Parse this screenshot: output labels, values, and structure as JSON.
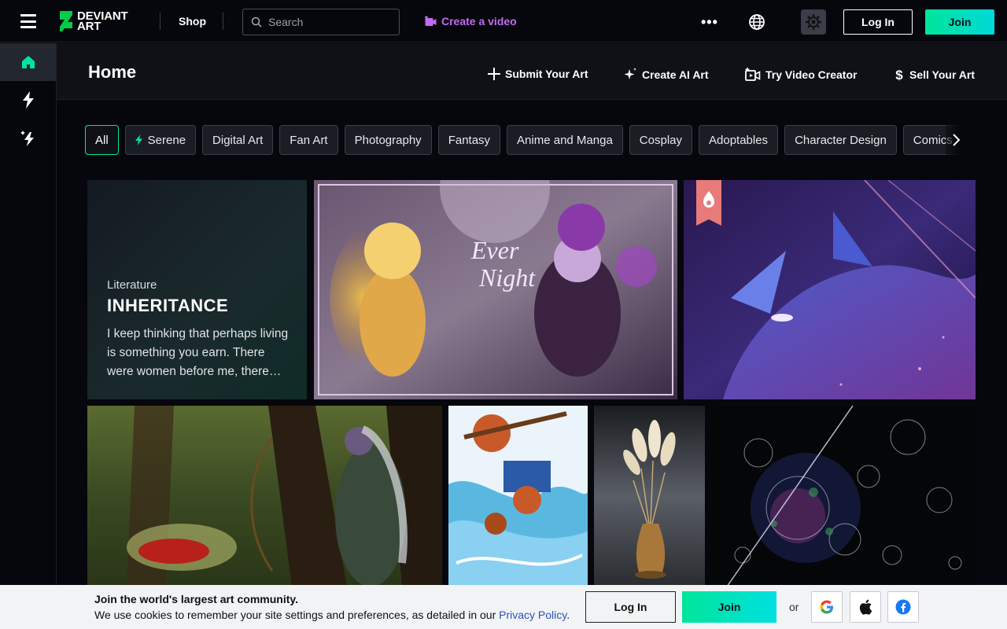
{
  "header": {
    "logo_line1": "DEVIANT",
    "logo_line2": "ART",
    "shop": "Shop",
    "search_placeholder": "Search",
    "create_video": "Create a video",
    "more": "•••",
    "login": "Log In",
    "join": "Join"
  },
  "sidebar": {
    "items": [
      {
        "icon": "home-icon",
        "active": true
      },
      {
        "icon": "lightning-icon",
        "active": false
      },
      {
        "icon": "sparkle-bolt-icon",
        "active": false
      }
    ]
  },
  "home": {
    "title": "Home",
    "actions": [
      "Submit Your Art",
      "Create AI Art",
      "Try Video Creator",
      "Sell Your Art"
    ]
  },
  "chips": [
    "All",
    "Serene",
    "Digital Art",
    "Fan Art",
    "Photography",
    "Fantasy",
    "Anime and Manga",
    "Cosplay",
    "Adoptables",
    "Character Design",
    "Comics"
  ],
  "literature": {
    "category": "Literature",
    "title": "INHERITANCE",
    "excerpt": "I keep thinking that perhaps living is something you earn. There were women before me, there were women before them"
  },
  "cookie": {
    "title": "Join the world's largest art community.",
    "text": "We use cookies to remember your site settings and preferences, as detailed in our ",
    "link": "Privacy Policy",
    "period": ".",
    "login": "Log In",
    "join": "Join",
    "or": "or"
  },
  "colors": {
    "accent_green": "#00e59b",
    "accent_purple": "#c06cf0",
    "background": "#06070d"
  }
}
